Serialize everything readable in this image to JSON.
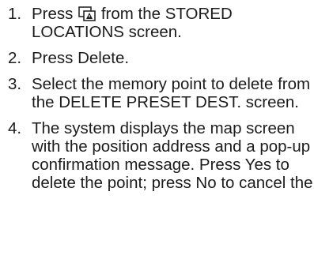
{
  "steps": [
    {
      "number": "1.",
      "before_icon": "Press",
      "icon": "map-screen-icon",
      "after_icon": "from the STORED LOCATIONS screen."
    },
    {
      "number": "2.",
      "text": "Press Delete."
    },
    {
      "number": "3.",
      "text": "Select the memory point to delete from the DELETE PRESET DEST. screen."
    },
    {
      "number": "4.",
      "text": "The system displays the map screen with the position address and a pop-up confirmation message. Press Yes to delete the point; press No to cancel the"
    }
  ]
}
